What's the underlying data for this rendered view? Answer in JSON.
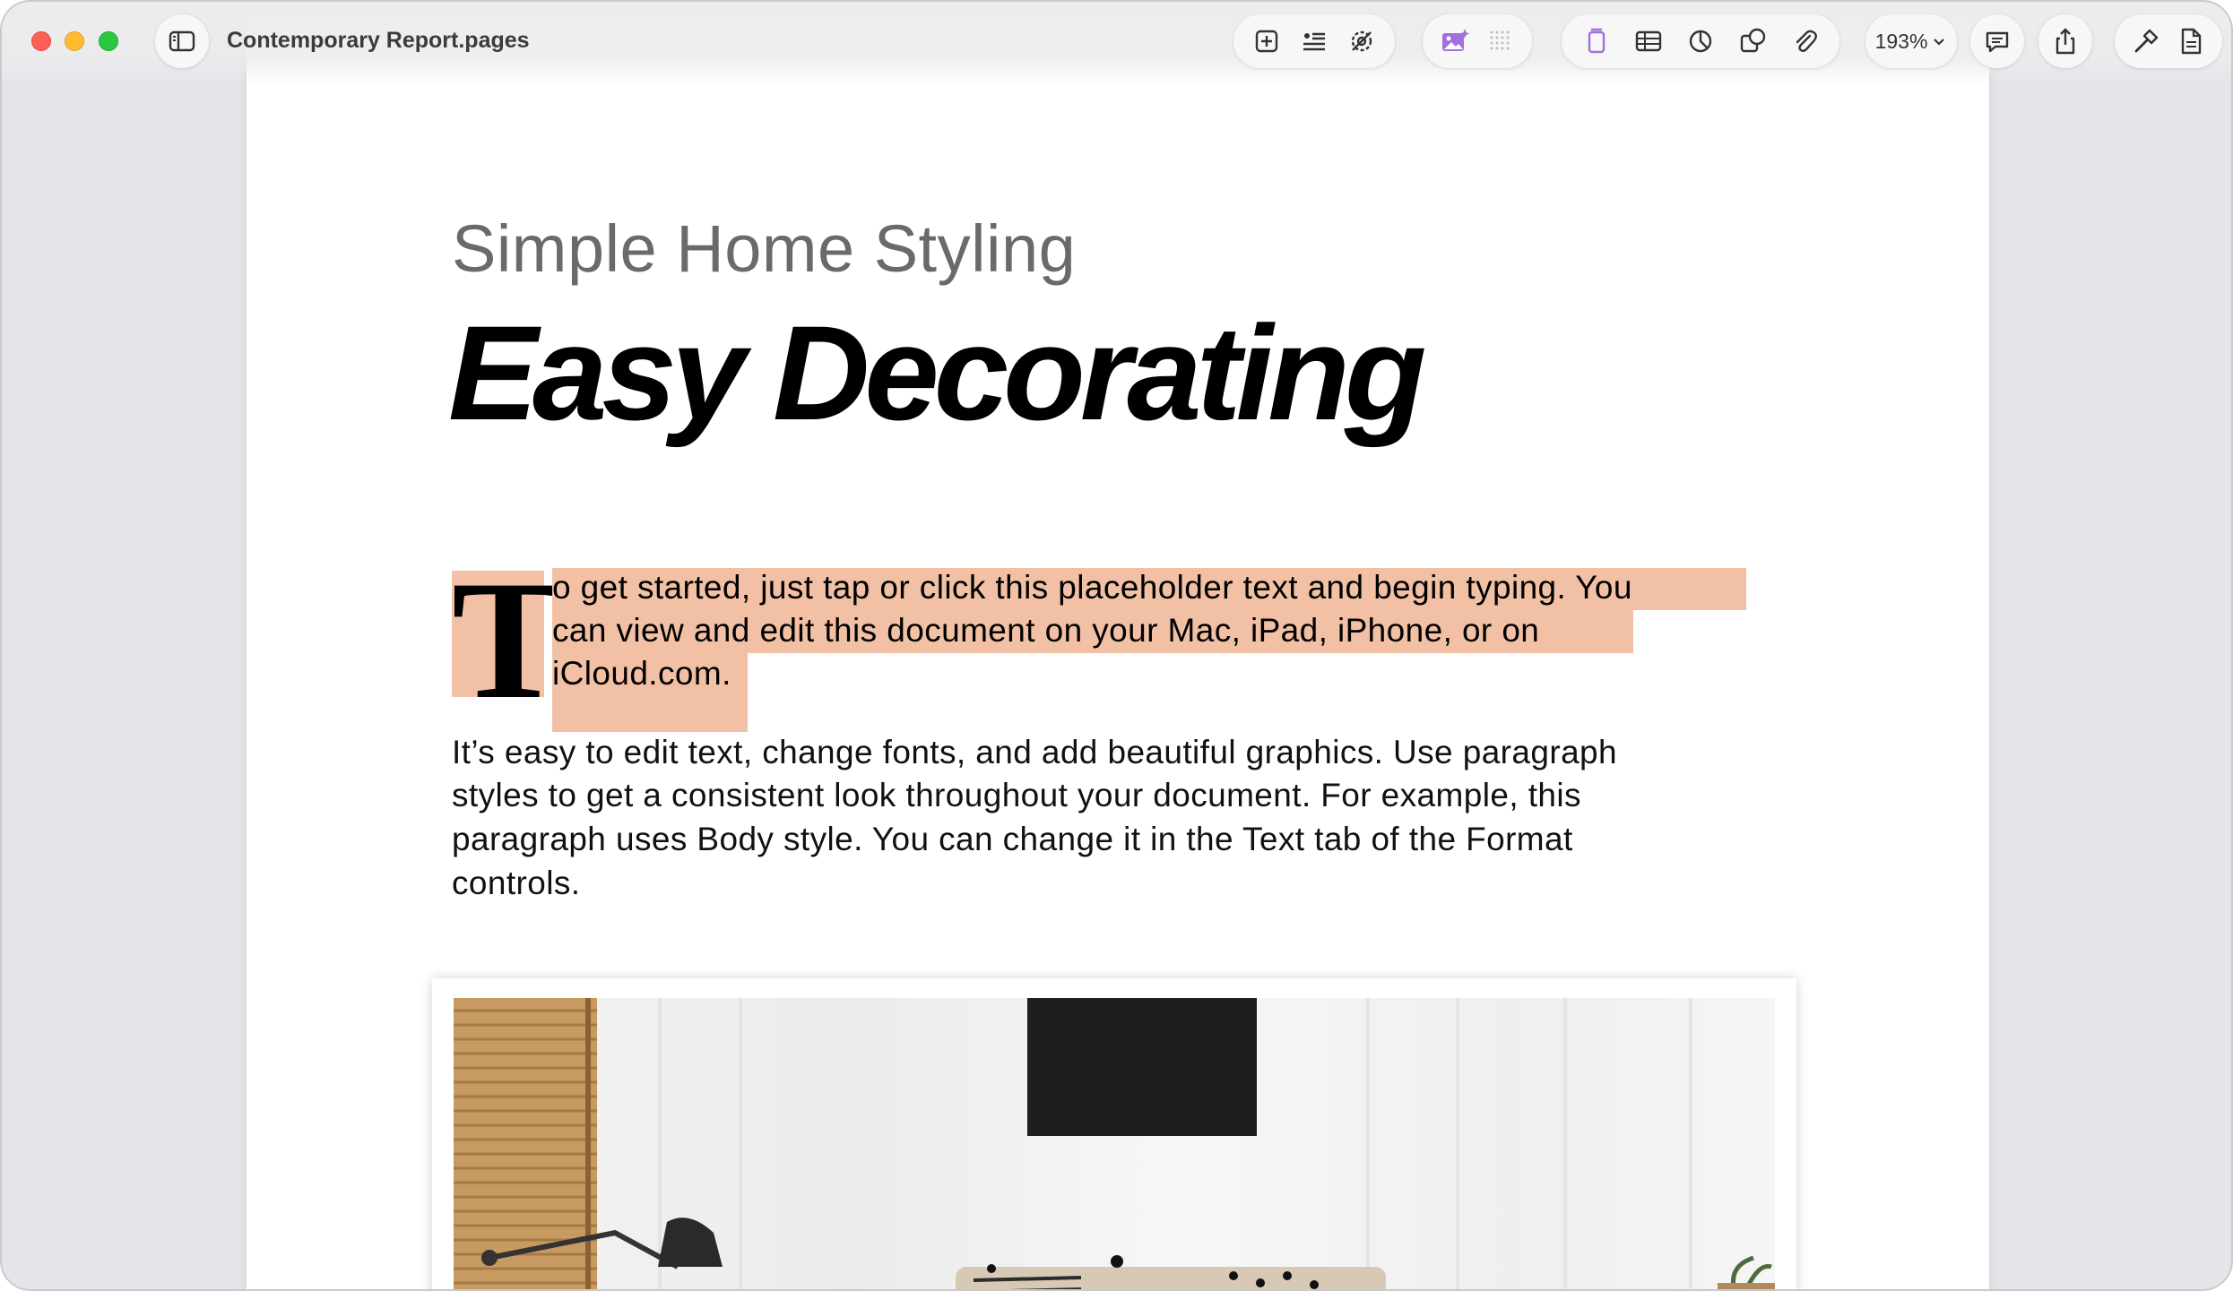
{
  "window": {
    "document_title": "Contemporary Report.pages",
    "zoom": "193%"
  },
  "toolbar": {
    "icons": [
      "sidebar-icon",
      "add-page-icon",
      "text-styles-icon",
      "settings-icon",
      "image-playground-icon",
      "grid-icon",
      "text-box-icon",
      "table-icon",
      "chart-icon",
      "shape-icon",
      "attachment-icon",
      "comment-icon",
      "share-icon",
      "format-icon",
      "document-icon"
    ],
    "accent_color": "#a36ee0"
  },
  "document": {
    "subtitle": "Simple Home Styling",
    "headline": "Easy Decorating",
    "drop_cap": "T",
    "selected_lines": [
      "o get started, just tap or click this placeholder text and begin typing. You",
      "can view and edit this document on your Mac, iPad, iPhone, or on",
      "iCloud.com."
    ],
    "body_lines": [
      "It’s easy to edit text, change fonts, and add beautiful graphics. Use paragraph",
      "styles to get a consistent look throughout your document. For example, this",
      "paragraph uses Body style. You can change it in the Text tab of the Format",
      "controls."
    ],
    "highlight_color": "#f2c1a5"
  }
}
